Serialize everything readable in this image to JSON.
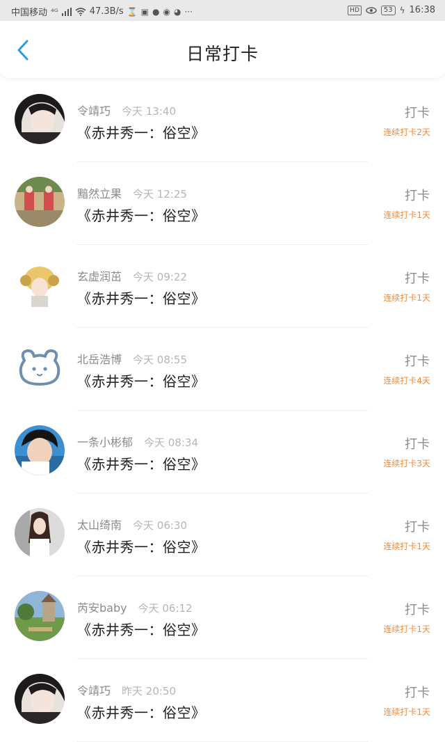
{
  "status_bar": {
    "carrier": "中国移动",
    "signal_label": "⁴ᴳ",
    "speed": "47.3B/s",
    "hd": "HD",
    "battery": "53",
    "time": "16:38"
  },
  "header": {
    "title": "日常打卡"
  },
  "colors": {
    "accent_blue": "#2d9be6",
    "streak_orange": "#f08a3a"
  },
  "checkins": [
    {
      "name": "令靖巧",
      "time": "今天 13:40",
      "book": "《赤井秀一：俗空》",
      "action": "打卡",
      "streak": "连续打卡2天"
    },
    {
      "name": "黯然立果",
      "time": "今天 12:25",
      "book": "《赤井秀一：俗空》",
      "action": "打卡",
      "streak": "连续打卡1天"
    },
    {
      "name": "玄虚润茁",
      "time": "今天 09:22",
      "book": "《赤井秀一：俗空》",
      "action": "打卡",
      "streak": "连续打卡1天"
    },
    {
      "name": "北岳浩博",
      "time": "今天 08:55",
      "book": "《赤井秀一：俗空》",
      "action": "打卡",
      "streak": "连续打卡4天"
    },
    {
      "name": "一条小彬郁",
      "time": "今天 08:34",
      "book": "《赤井秀一：俗空》",
      "action": "打卡",
      "streak": "连续打卡3天"
    },
    {
      "name": "太山绮南",
      "time": "今天 06:30",
      "book": "《赤井秀一：俗空》",
      "action": "打卡",
      "streak": "连续打卡1天"
    },
    {
      "name": "芮安baby",
      "time": "今天 06:12",
      "book": "《赤井秀一：俗空》",
      "action": "打卡",
      "streak": "连续打卡1天"
    },
    {
      "name": "令靖巧",
      "time": "昨天 20:50",
      "book": "《赤井秀一：俗空》",
      "action": "打卡",
      "streak": "连续打卡1天"
    }
  ]
}
